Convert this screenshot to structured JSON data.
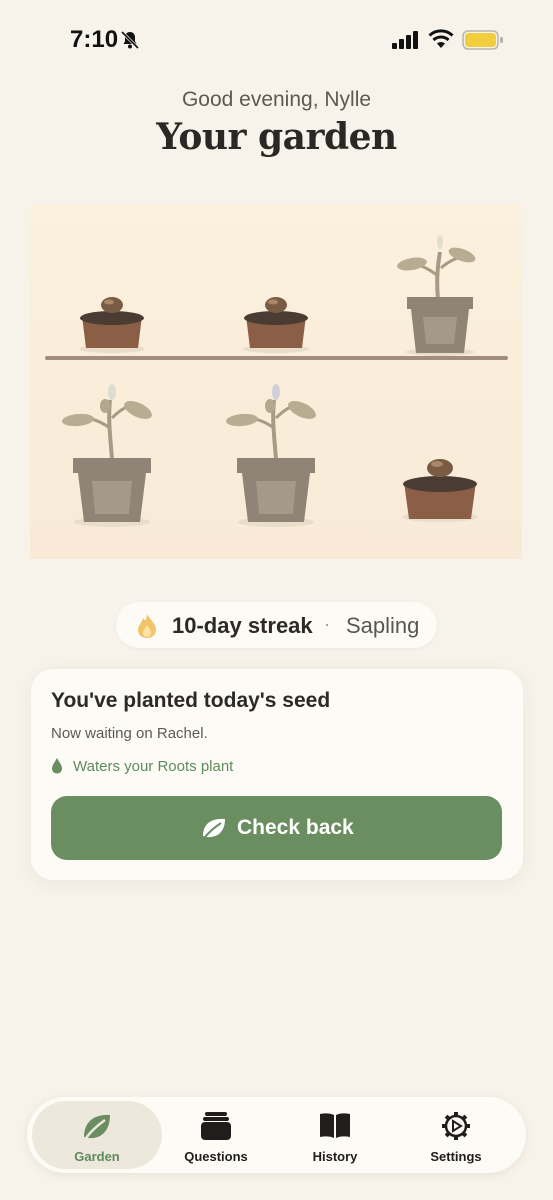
{
  "status_bar": {
    "time": "7:10",
    "icons": [
      "bell-slash-icon",
      "signal-icon",
      "wifi-icon",
      "battery-icon"
    ],
    "battery_color": "#f2cd3c"
  },
  "header": {
    "greeting": "Good evening, Nylle",
    "title": "Your garden"
  },
  "garden": {
    "icons": [
      "seed-pot-icon",
      "sprout-pot-icon"
    ]
  },
  "streak": {
    "icon": "flame-icon",
    "label": "10-day streak",
    "separator": "·",
    "stage": "Sapling"
  },
  "card": {
    "title": "You've planted today's seed",
    "subtitle": "Now waiting on Rachel.",
    "note_icon": "water-drop-icon",
    "note": "Waters your Roots plant",
    "button_icon": "leaf-icon",
    "button_label": "Check back"
  },
  "nav": {
    "items": [
      {
        "label": "Garden",
        "icon": "leaf-icon",
        "active": true
      },
      {
        "label": "Questions",
        "icon": "cards-icon",
        "active": false
      },
      {
        "label": "History",
        "icon": "book-icon",
        "active": false
      },
      {
        "label": "Settings",
        "icon": "gear-icon",
        "active": false
      }
    ]
  },
  "colors": {
    "background": "#f7f3ea",
    "accent_green": "#6b8e61",
    "active_nav_label": "#5f8a5c",
    "card_background": "#fdfbf5"
  }
}
